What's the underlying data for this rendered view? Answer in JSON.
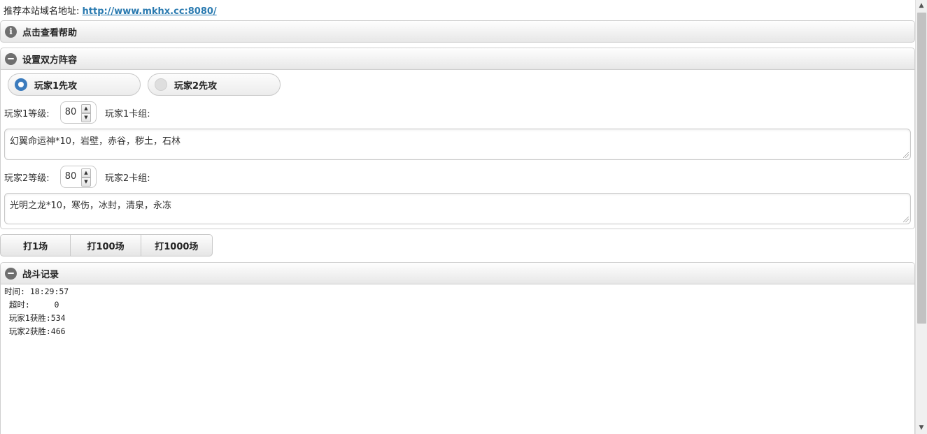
{
  "site": {
    "label": "推荐本站域名地址:",
    "url": "http://www.mkhx.cc:8080/"
  },
  "help_panel": {
    "title": "点击查看帮助",
    "icon": "info-icon"
  },
  "lineup_panel": {
    "title": "设置双方阵容",
    "icon": "minus-circle-icon",
    "first_attack_options": [
      {
        "label": "玩家1先攻",
        "selected": true
      },
      {
        "label": "玩家2先攻",
        "selected": false
      }
    ],
    "player1": {
      "level_label": "玩家1等级:",
      "level": "80",
      "deck_label": "玩家1卡组:",
      "deck": "幻翼命运神*10，岩壁，赤谷，秽土，石林"
    },
    "player2": {
      "level_label": "玩家2等级:",
      "level": "80",
      "deck_label": "玩家2卡组:",
      "deck": "光明之龙*10，寒伤，冰封，清泉，永冻"
    }
  },
  "actions": [
    "打1场",
    "打100场",
    "打1000场"
  ],
  "battle_log_panel": {
    "title": "战斗记录",
    "icon": "minus-circle-icon",
    "lines": [
      "时间: 18:29:57",
      " 超时:     0",
      " 玩家1获胜:534",
      " 玩家2获胜:466"
    ]
  },
  "colors": {
    "accent": "#3b7bbd",
    "link": "#2a7ab0"
  }
}
